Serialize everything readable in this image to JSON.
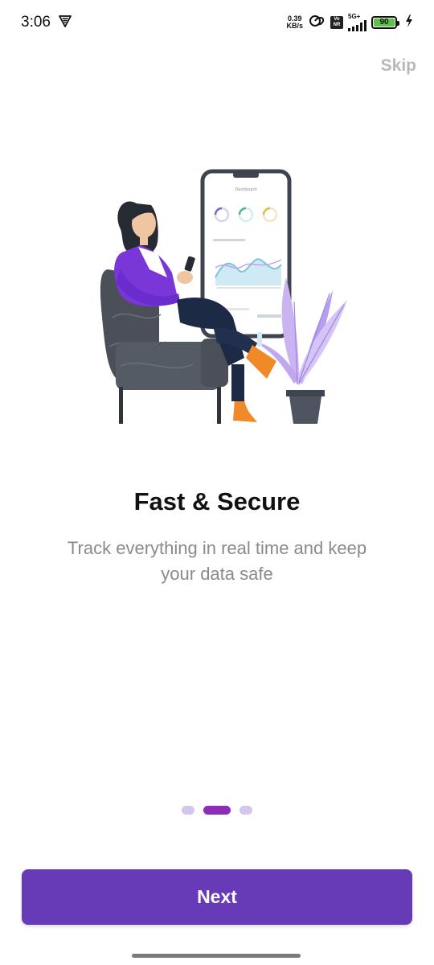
{
  "status_bar": {
    "time": "3:06",
    "net_speed_value": "0.39",
    "net_speed_unit": "KB/s",
    "volte_top": "Vo",
    "volte_bottom": "NR",
    "network_type": "5G+",
    "battery_level": "90",
    "battery_color": "#5cc24a",
    "icons": [
      "vpn-shield-icon",
      "link-icon",
      "volte-icon",
      "signal-icon",
      "battery-icon",
      "charging-bolt-icon"
    ]
  },
  "onboarding": {
    "skip_label": "Skip",
    "title": "Fast & Secure",
    "subtitle": "Track everything in real time and keep your data safe",
    "page_count": 3,
    "current_page": 2,
    "next_label": "Next"
  },
  "colors": {
    "primary": "#673ab7",
    "active_dot": "#8e2cb8",
    "inactive_dot": "#d4c6ec",
    "skip_text": "#b9b9b9",
    "subtitle_text": "#8a8a8a"
  }
}
